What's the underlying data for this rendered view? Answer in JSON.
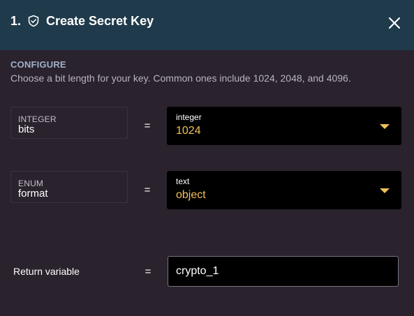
{
  "header": {
    "step_number": "1.",
    "title": "Create Secret Key",
    "icon": "shield-check-icon",
    "close_icon": "close-icon"
  },
  "configure": {
    "heading": "CONFIGURE",
    "description": "Choose a bit length for your key. Common ones include 1024, 2048, and 4096."
  },
  "params": [
    {
      "type_label": "INTEGER",
      "name": "bits",
      "equals": "=",
      "value_type": "integer",
      "value": "1024"
    },
    {
      "type_label": "ENUM",
      "name": "format",
      "equals": "=",
      "value_type": "text",
      "value": "object"
    }
  ],
  "return_variable": {
    "label": "Return variable",
    "equals": "=",
    "value": "crypto_1"
  },
  "colors": {
    "header_bg": "#1f3a4a",
    "body_bg": "#2a222d",
    "accent": "#f0c15a",
    "heading": "#9fb0c8"
  }
}
